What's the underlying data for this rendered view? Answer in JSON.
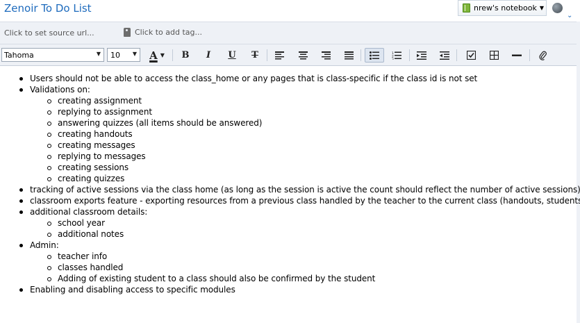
{
  "app": {
    "title": "Zenoir To Do List"
  },
  "notebook": {
    "label": "nrew's notebook"
  },
  "meta_bar": {
    "source_url_placeholder": "Click to set source url...",
    "tag_placeholder": "Click to add tag..."
  },
  "toolbar": {
    "font_family": "Tahoma",
    "font_size": "10",
    "buttons": [
      "font-color",
      "bold",
      "italic",
      "underline",
      "strikethrough",
      "align-left",
      "align-center",
      "align-right",
      "align-justify",
      "bulleted-list",
      "numbered-list",
      "indent",
      "outdent",
      "checkbox",
      "table",
      "horizontal-rule",
      "attachment"
    ],
    "active_button": "bulleted-list"
  },
  "colors": {
    "title": "#1e6bbd",
    "bar_bg": "#eef1f6",
    "notebook_icon": "#7fb53a"
  },
  "note": {
    "items": [
      {
        "text": "Users should not be able to access the class_home or any pages that is class-specific if the class id is not set",
        "children": []
      },
      {
        "text": "Validations on:",
        "children": [
          "creating assignment",
          "replying to assignment",
          "answering quizzes (all items should be answered)",
          "creating handouts",
          "creating messages",
          "replying to messages",
          "creating sessions",
          "creating quizzes"
        ]
      },
      {
        "text": "tracking of active sessions via the class home (as long as the session is active the count should reflect the number of active sessions)",
        "children": []
      },
      {
        "text": "classroom exports feature - exporting resources from a previous class handled by the teacher to the current class (handouts, students)",
        "children": []
      },
      {
        "text": "additional classroom details:",
        "children": [
          "school year",
          "additional notes"
        ]
      },
      {
        "text": "Admin:",
        "children": [
          "teacher info",
          "classes handled",
          "Adding of existing student to a class should also be confirmed by the student"
        ]
      },
      {
        "text": "Enabling and disabling access to specific modules",
        "children": []
      }
    ]
  }
}
